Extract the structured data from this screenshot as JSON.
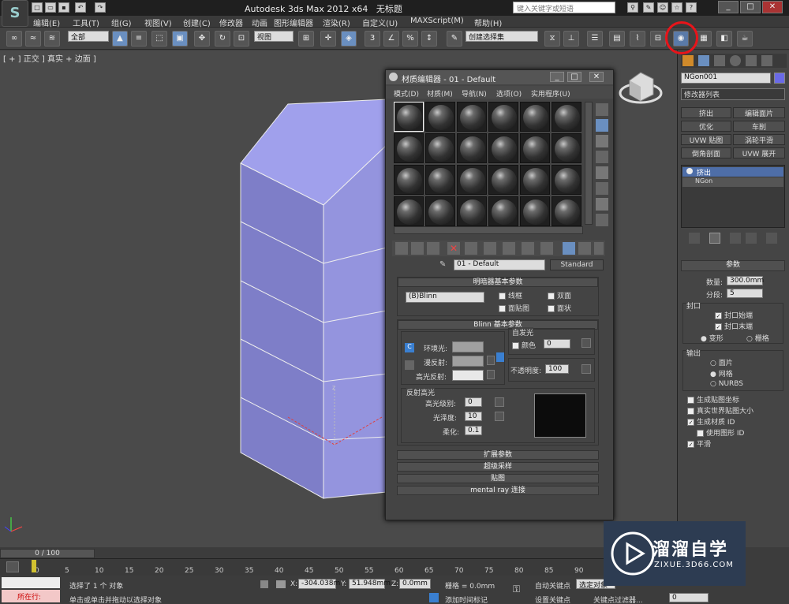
{
  "app": {
    "logo_glyph": "S",
    "title": "Autodesk 3ds Max  2012 x64",
    "file_title": "无标题",
    "search_placeholder": "键入关键字或短语",
    "window_controls": [
      "_",
      "□",
      "✕"
    ]
  },
  "menubar": [
    "编辑(E)",
    "工具(T)",
    "组(G)",
    "视图(V)",
    "创建(C)",
    "修改器",
    "动画",
    "图形编辑器",
    "渲染(R)",
    "自定义(U)",
    "MAXScript(M)",
    "帮助(H)"
  ],
  "toolbar": {
    "filter_select": "全部",
    "refcoord_select": "视图",
    "named_selection": "创建选择集",
    "snap_labels": [
      "3",
      "%"
    ],
    "highlighted_tool": "material-editor-icon"
  },
  "viewport": {
    "label": "[ + ] 正交  ] 真实  + 边面 ]",
    "object_color": "#9a9ae0",
    "axis_labels": [
      "z"
    ]
  },
  "material_editor": {
    "title": "材质编辑器 - 01 - Default",
    "menus": [
      "模式(D)",
      "材质(M)",
      "导航(N)",
      "选项(O)",
      "实用程序(U)"
    ],
    "material_name": "01 - Default",
    "material_type": "Standard",
    "shader_rollout": "明暗器基本参数",
    "shader": "(B)Blinn",
    "shader_opts": [
      "线框",
      "双面",
      "面贴图",
      "面状"
    ],
    "blinn_rollout": "Blinn 基本参数",
    "self_illum": "自发光",
    "ambient": "环境光:",
    "diffuse": "漫反射:",
    "specular": "高光反射:",
    "color_label": "颜色",
    "color_value": "0",
    "opacity_label": "不透明度:",
    "opacity_value": "100",
    "spec_group": "反射高光",
    "spec_level_label": "高光级别:",
    "spec_level": "0",
    "gloss_label": "光泽度:",
    "gloss": "10",
    "soften_label": "柔化:",
    "soften": "0.1",
    "rollouts": [
      "扩展参数",
      "超级采样",
      "贴图",
      "mental ray 连接"
    ]
  },
  "cmd_panel": {
    "object_name": "NGon001",
    "object_color": "#6a6ae8",
    "modifier_list": "修改器列表",
    "mod_buttons": [
      "挤出",
      "编辑面片",
      "优化",
      "车削",
      "UVW 贴图",
      "涡轮平滑",
      "倒角剖面",
      "UVW 展开"
    ],
    "stack": [
      "挤出",
      "NGon"
    ],
    "params_title": "参数",
    "amount_label": "数量:",
    "amount": "300.0mm",
    "segments_label": "分段:",
    "segments": "5",
    "capping": "封口",
    "cap_start": "封口始端",
    "cap_end": "封口末端",
    "morph": "变形",
    "grid": "栅格",
    "output": "输出",
    "patch": "面片",
    "mesh": "网格",
    "nurbs": "NURBS",
    "gen_map": "生成贴图坐标",
    "real_world": "真实世界贴图大小",
    "gen_matid": "生成材质 ID",
    "use_shape": "使用图形 ID",
    "smooth": "平滑"
  },
  "timeline": {
    "frame": "0 / 100",
    "ticks": [
      "0",
      "5",
      "10",
      "15",
      "20",
      "25",
      "30",
      "35",
      "40",
      "45",
      "50",
      "55",
      "60",
      "65",
      "70",
      "75",
      "80",
      "85",
      "90"
    ]
  },
  "status": {
    "script_label": "所在行:",
    "selection": "选择了 1 个 对象",
    "prompt": "单击或单击并拖动以选择对象",
    "x_label": "X:",
    "x": "-304.038m",
    "y_label": "Y:",
    "y": "51.948mm",
    "z_label": "Z:",
    "z": "0.0mm",
    "grid": "栅格 = 0.0mm",
    "auto_key": "自动关键点",
    "set_key": "设置关键点",
    "selected": "选定对象",
    "key_filters": "关键点过滤器...",
    "add_tag": "添加时间标记",
    "frame_field": "0"
  },
  "watermark": {
    "brand": "溜溜自学",
    "url": "ZIXUE.3D66.COM"
  }
}
